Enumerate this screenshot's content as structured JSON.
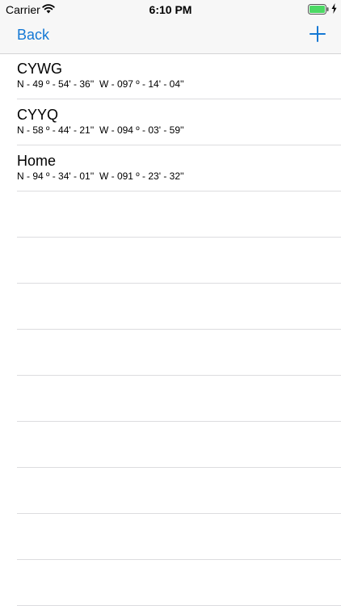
{
  "status_bar": {
    "carrier": "Carrier",
    "time": "6:10 PM",
    "battery_color": "#4cd964"
  },
  "nav": {
    "back_label": "Back",
    "add_icon": "plus-icon",
    "accent": "#1478d4"
  },
  "locations": [
    {
      "name": "CYWG",
      "coords": "N - 49 º - 54' - 36''  W - 097 º - 14' - 04''"
    },
    {
      "name": "CYYQ",
      "coords": "N - 58 º - 44' - 21''  W - 094 º - 03' - 59''"
    },
    {
      "name": "Home",
      "coords": "N - 94 º - 34' - 01''  W - 091 º - 23' - 32''"
    }
  ]
}
